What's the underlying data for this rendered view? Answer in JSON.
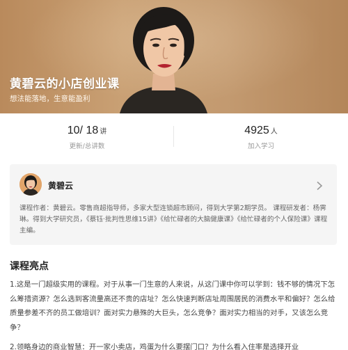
{
  "hero": {
    "title": "黄碧云的小店创业课",
    "subtitle": "想法能落地，生意能盈利"
  },
  "stats": {
    "updated": {
      "value": "10/ 18",
      "unit": "讲",
      "label": "更新/总讲数"
    },
    "learners": {
      "value": "4925",
      "unit": "人",
      "label": "加入学习"
    }
  },
  "author": {
    "name": "黄碧云",
    "description": "课程作者：黄碧云。零售商超指导师，多家大型连锁超市顾问，得到大学第2期学员。 课程研发者：杨霁琳。得到大学研究员，《蔡钰·批判性思维15讲》《给忙碌者的大脑健康课》《给忙碌者的个人保险课》课程主编。"
  },
  "highlights": {
    "title": "课程亮点",
    "paragraphs": [
      "1.这是一门超级实用的课程。对于从事一门生意的人来说，从这门课中你可以学到：钱不够的情况下怎么筹措资源？怎么选到客流量高还不贵的店址？怎么快速判断店址周围居民的消费水平和偏好？怎么给质量参差不齐的员工做培训？面对实力悬殊的大巨头，怎么竞争？面对实力相当的对手，又该怎么竞争？",
      "2.领略身边的商业智慧：开一家小卖店，鸡蛋为什么要摆门口？为什么看入住率是选择开业"
    ]
  },
  "colors": {
    "hero_bg": "#c39a70",
    "card_bg": "#f5f5f5",
    "text_primary": "#222222",
    "text_secondary": "#999999"
  }
}
